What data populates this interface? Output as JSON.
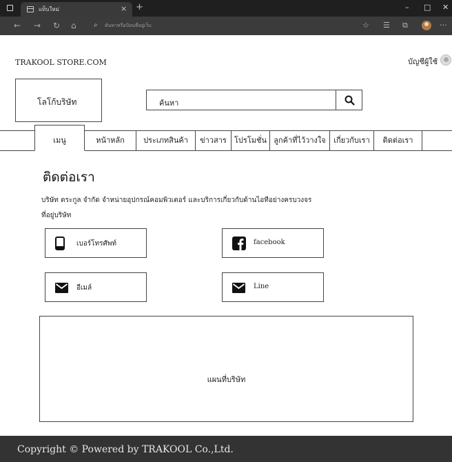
{
  "browser": {
    "tab_title": "แท็บใหม่",
    "tab_close": "×",
    "new_tab": "+",
    "address_placeholder": "ค้นหาหรือป้อนที่อยู่เว็บ",
    "window_minimize": "–",
    "window_maximize": "□",
    "window_close": "✕"
  },
  "header": {
    "store_name": "TRAKOOL STORE.COM",
    "account_label": "บัญชีผู้ใช้",
    "logo_text": "โลโก้บริษัท",
    "search_text": "ค้นหา"
  },
  "menu": {
    "items": [
      "เมนู",
      "หน้าหลัก",
      "ประเภทสินค้า",
      "ข่าวสาร",
      "โปรโมชั่น",
      "ลูกค้าที่ไว้วางใจ",
      "เกี่ยวกับเรา",
      "ติดต่อเรา"
    ]
  },
  "contact": {
    "title": "ติดต่อเรา",
    "description": "บริษัท ตระกูล จำกัด จำหน่ายอุปกรณ์คอมพิวเตอร์ และบริการเกี่ยวกับด้านไอทีอย่างครบวงจร",
    "address_label": "ที่อยู่บริษัท",
    "phone_label": "เบอร์โทรศัพท์",
    "facebook_label": "facebook",
    "email_label": "อีเมล์",
    "line_label": "Line"
  },
  "map": {
    "label": "แผนที่บริษัท"
  },
  "footer": {
    "copyright": "Copyright © Powered by TRAKOOL Co.,Ltd."
  }
}
